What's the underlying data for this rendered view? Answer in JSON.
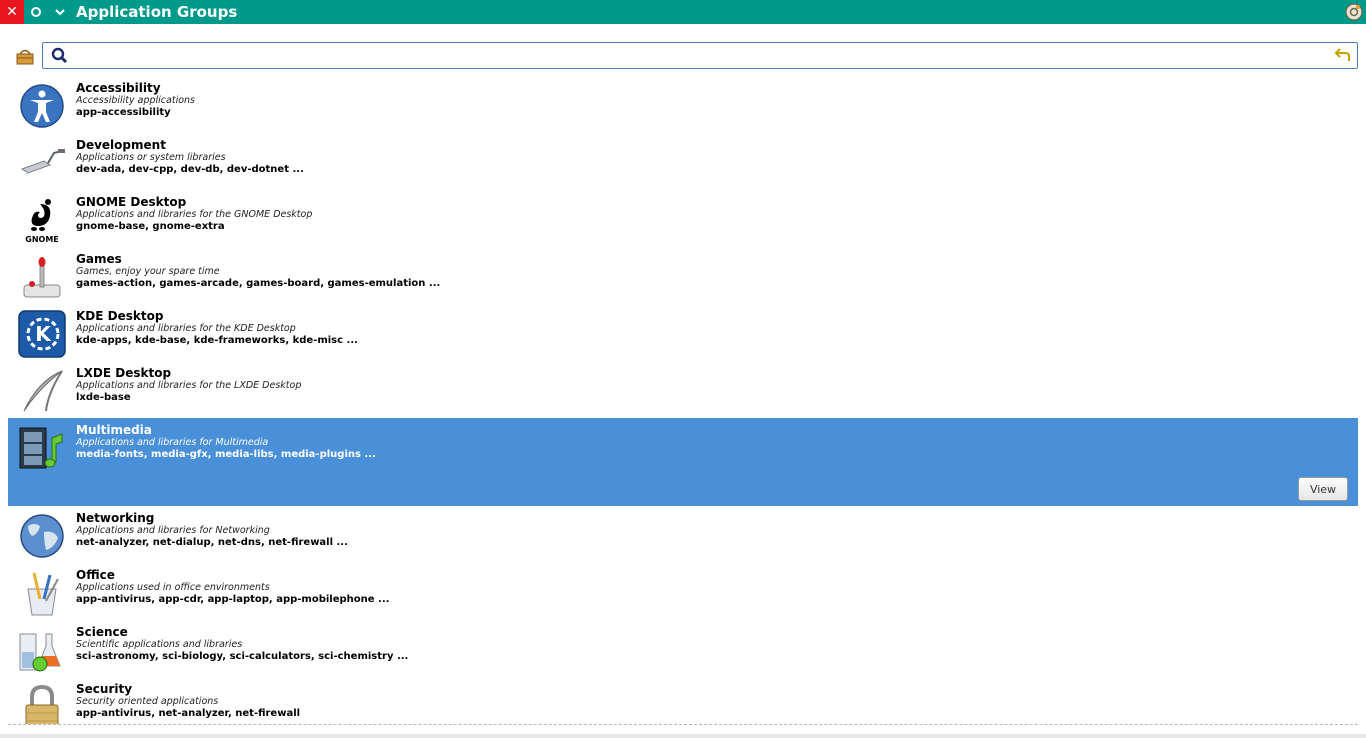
{
  "window": {
    "title": "Application Groups",
    "close_glyph": "✕"
  },
  "search": {
    "value": "",
    "placeholder": ""
  },
  "view_label": "View",
  "groups": [
    {
      "name": "Accessibility",
      "desc": "Accessibility applications",
      "pkgs": "app-accessibility",
      "icon": "accessibility-icon"
    },
    {
      "name": "Development",
      "desc": "Applications or system libraries",
      "pkgs": "dev-ada, dev-cpp, dev-db, dev-dotnet ...",
      "icon": "trowel-icon"
    },
    {
      "name": "GNOME Desktop",
      "desc": "Applications and libraries for the GNOME Desktop",
      "pkgs": "gnome-base, gnome-extra",
      "icon": "gnome-icon",
      "icon_label": "GNOME"
    },
    {
      "name": "Games",
      "desc": "Games, enjoy your spare time",
      "pkgs": "games-action, games-arcade, games-board, games-emulation ...",
      "icon": "joystick-icon"
    },
    {
      "name": "KDE Desktop",
      "desc": "Applications and libraries for the KDE Desktop",
      "pkgs": "kde-apps, kde-base, kde-frameworks, kde-misc ...",
      "icon": "kde-icon",
      "icon_label": "K"
    },
    {
      "name": "LXDE Desktop",
      "desc": "Applications and libraries for the LXDE Desktop",
      "pkgs": "lxde-base",
      "icon": "lxde-icon"
    },
    {
      "name": "Multimedia",
      "desc": "Applications and libraries for Multimedia",
      "pkgs": "media-fonts, media-gfx, media-libs, media-plugins ...",
      "icon": "multimedia-icon",
      "selected": true
    },
    {
      "name": "Networking",
      "desc": "Applications and libraries for Networking",
      "pkgs": "net-analyzer, net-dialup, net-dns, net-firewall ...",
      "icon": "globe-icon"
    },
    {
      "name": "Office",
      "desc": "Applications used in office environments",
      "pkgs": "app-antivirus, app-cdr, app-laptop, app-mobilephone ...",
      "icon": "office-icon"
    },
    {
      "name": "Science",
      "desc": "Scientific applications and libraries",
      "pkgs": "sci-astronomy, sci-biology, sci-calculators, sci-chemistry ...",
      "icon": "flask-icon"
    },
    {
      "name": "Security",
      "desc": "Security oriented applications",
      "pkgs": "app-antivirus, net-analyzer, net-firewall",
      "icon": "padlock-icon"
    }
  ],
  "colors": {
    "titlebar": "#009a8a",
    "close": "#e8141e",
    "selection": "#4a90d9"
  }
}
